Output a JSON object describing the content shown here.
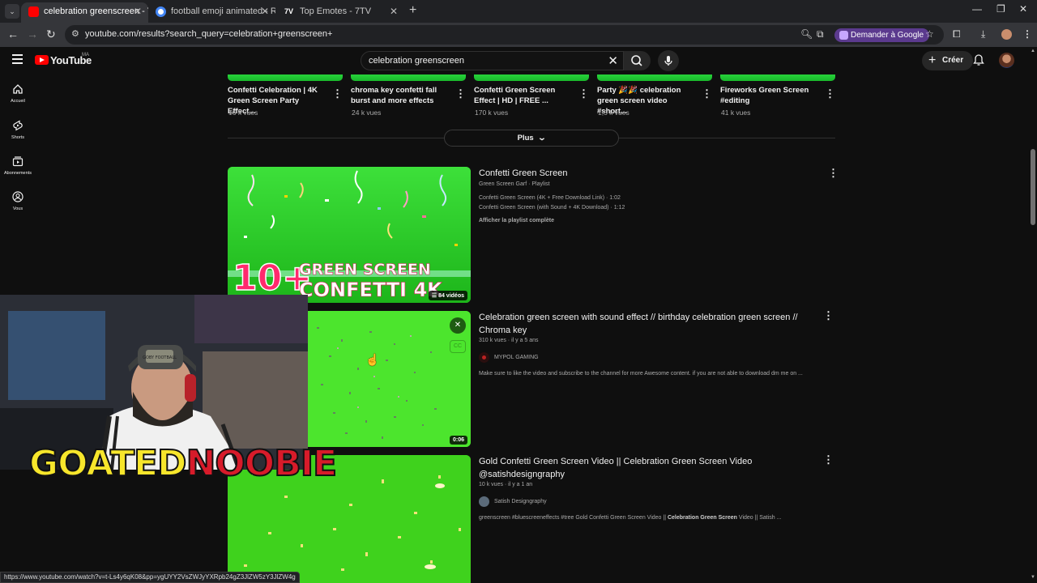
{
  "browser": {
    "tabs": [
      {
        "title": "celebration greenscreen - YouTube",
        "favicon_color": "#ff0000",
        "active": true
      },
      {
        "title": "football emoji animated - Recherche",
        "favicon_color": "#4285f4",
        "active": false
      },
      {
        "title": "Top Emotes - 7TV",
        "favicon_color": "#ffffff",
        "active": false
      }
    ],
    "url": "youtube.com/results?search_query=celebration+greenscreen+",
    "ask_google_label": "Demander à Google",
    "status_url": "https://www.youtube.com/watch?v=t-Ls4y6qK08&pp=ygUYY2VsZWJyYXRpb24gZ3JlZW5zY3JlZW4g"
  },
  "youtube": {
    "wordmark": "YouTube",
    "region": "MA",
    "search_query": "celebration greenscreen",
    "create_label": "Créer",
    "sidenav": [
      {
        "label": "Accueil",
        "icon": "home-icon"
      },
      {
        "label": "Shorts",
        "icon": "shorts-icon"
      },
      {
        "label": "Abonnements",
        "icon": "subscriptions-icon"
      },
      {
        "label": "Vous",
        "icon": "you-icon"
      }
    ]
  },
  "shelf": {
    "items": [
      {
        "title": "Confetti Celebration | 4K Green Screen Party Effect...",
        "views": "16 k vues"
      },
      {
        "title": "chroma key confetti fall burst and more effects",
        "views": "24 k vues"
      },
      {
        "title": "Confetti Green Screen Effect | HD | FREE ...",
        "views": "170 k vues"
      },
      {
        "title": "Party 🎉🎉 celebration green screen video #short...",
        "views": "1,5 k vues"
      },
      {
        "title": "Fireworks Green Screen #editing",
        "views": "41 k vues"
      }
    ],
    "more_label": "Plus"
  },
  "results": [
    {
      "type": "playlist",
      "title": "Confetti Green Screen",
      "subtitle": "Green Screen Garf · Playlist",
      "entries": [
        "Confetti Green Screen (4K + Free Download Link) · 1:02",
        "Confetti Green Screen (with Sound + 4K Download) · 1:12"
      ],
      "view_full": "Afficher la playlist complète",
      "badge": "84 vidéos",
      "thumb_text_1": "10+",
      "thumb_text_2": "GREEN SCREEN",
      "thumb_text_3": "CONFETTI 4K"
    },
    {
      "type": "video",
      "title": "Celebration green screen with sound effect // birthday celebration green screen // Chroma key",
      "meta": "310 k vues · il y a 5 ans",
      "channel": "MYPOL GAMING",
      "channel_color": "#8b1a1a",
      "description": "Make sure to like the video and subscribe to the channel for more Awesome content. if you are not able to download dm me on ...",
      "duration": "0:06"
    },
    {
      "type": "video",
      "title": "Gold Confetti Green Screen Video || Celebration Green Screen Video @satishdesigngraphy",
      "meta": "10 k vues · il y a 1 an",
      "channel": "Satish Designgraphy",
      "channel_color": "#5b6b7a",
      "description_plain": "greenscreen #bluescreeneffects #tree Gold Confetti Green Screen Video || ",
      "description_bold": "Celebration Green Screen",
      "description_tail": " Video || Satish ..."
    }
  ],
  "overlay": {
    "name_part1": "GOATED",
    "name_part2": "NOOBIE",
    "cap_text": "GOBY FOOTBALL"
  }
}
